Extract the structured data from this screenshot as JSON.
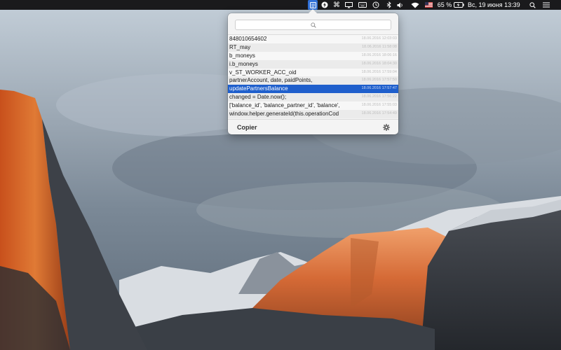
{
  "menubar": {
    "battery_percent": "65 %",
    "clock": "Вс, 19 июня  13:39",
    "icons": [
      "clipboard-app-icon",
      "flash-icon",
      "command-icon",
      "display-icon",
      "keyboard-icon",
      "time-machine-icon",
      "bluetooth-icon",
      "volume-icon",
      "wifi-icon",
      "us-flag-icon",
      "battery-icon",
      "search-icon",
      "list-icon"
    ]
  },
  "popover": {
    "search": {
      "value": "",
      "placeholder": ""
    },
    "items": [
      {
        "text": "848010654602",
        "time": "18.06.2016 12:03:03"
      },
      {
        "text": "RT_may",
        "time": "18.06.2016 11:58:08"
      },
      {
        "text": "b_moneys",
        "time": "18.06.2016 18:06:16"
      },
      {
        "text": "i.b_moneys",
        "time": "18.06.2016 18:04:30"
      },
      {
        "text": "v_ST_WORKER_ACC_oid",
        "time": "18.06.2016 17:59:04"
      },
      {
        "text": "partnerAccount, date, paidPoints,",
        "time": "18.06.2016 17:57:50"
      },
      {
        "text": "updatePartnersBalance",
        "time": "18.06.2016 17:57:47",
        "selected": true
      },
      {
        "text": "changed = Date.now();",
        "time": "18.06.2016 17:56:22"
      },
      {
        "text": "['balance_id', 'balance_partner_id', 'balance',",
        "time": "18.06.2016 17:55:03"
      },
      {
        "text": "window.helper.generateId(this.operationCod",
        "time": "18.06.2016 17:54:49"
      }
    ],
    "footer": {
      "app_name": "Copier"
    }
  },
  "colors": {
    "selection": "#1f5fcc",
    "menubar": "#1a1a1c"
  }
}
